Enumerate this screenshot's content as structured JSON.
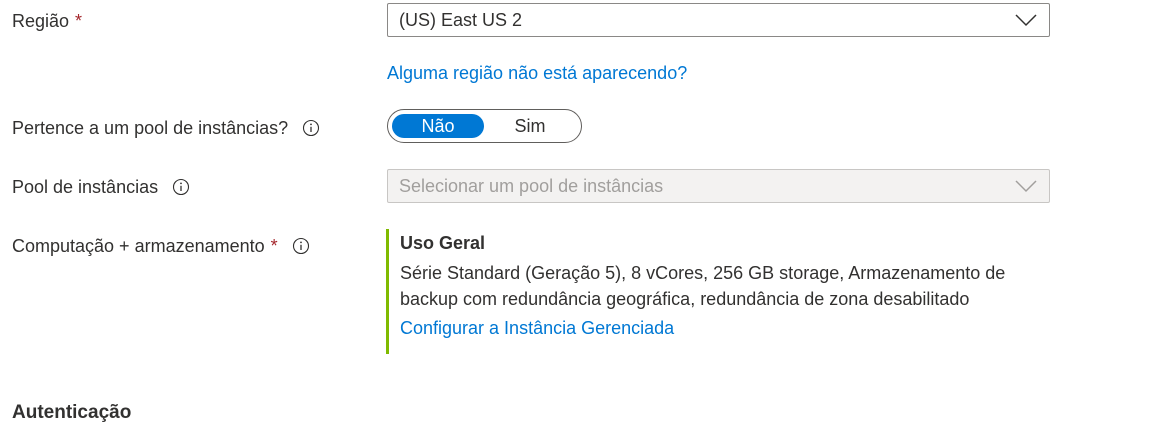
{
  "region": {
    "label": "Região",
    "required_mark": "*",
    "value": "(US) East US 2",
    "help_link": "Alguma região não está aparecendo?"
  },
  "instance_pool_membership": {
    "label": "Pertence a um pool de instâncias?",
    "options": [
      "Não",
      "Sim"
    ],
    "selected": "Não"
  },
  "instance_pool": {
    "label": "Pool de instâncias",
    "placeholder": "Selecionar um pool de instâncias",
    "disabled": true
  },
  "compute_storage": {
    "label": "Computação + armazenamento",
    "required_mark": "*",
    "tier_title": "Uso Geral",
    "description": "Série Standard (Geração 5), 8 vCores, 256 GB storage, Armazenamento de backup com redundância geográfica, redundância de zona desabilitado",
    "configure_link": "Configurar a Instância Gerenciada"
  },
  "authentication": {
    "title": "Autenticação"
  },
  "colors": {
    "accent": "#0078d4",
    "required": "#a4262c",
    "card_border": "#7fba00",
    "text": "#323130"
  }
}
